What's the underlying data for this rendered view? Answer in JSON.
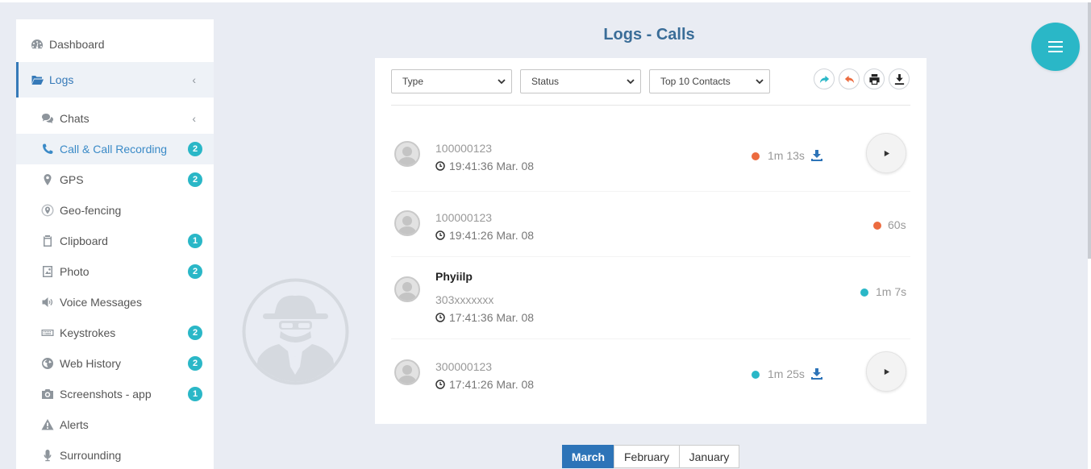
{
  "page": {
    "title": "Logs - Calls"
  },
  "sidebar": {
    "top_items": [
      {
        "label": "Dashboard",
        "icon": "dashboard-icon"
      },
      {
        "label": "Logs",
        "icon": "folder-open-icon"
      }
    ],
    "sub_items": [
      {
        "label": "Chats",
        "icon": "chat-bubbles-icon",
        "badge": ""
      },
      {
        "label": "Call & Call Recording",
        "icon": "phone-icon",
        "badge": "2"
      },
      {
        "label": "GPS",
        "icon": "map-marker-icon",
        "badge": "2"
      },
      {
        "label": "Geo-fencing",
        "icon": "geofence-icon",
        "badge": ""
      },
      {
        "label": "Clipboard",
        "icon": "clipboard-icon",
        "badge": "1"
      },
      {
        "label": "Photo",
        "icon": "photo-icon",
        "badge": "2"
      },
      {
        "label": "Voice Messages",
        "icon": "volume-icon",
        "badge": ""
      },
      {
        "label": "Keystrokes",
        "icon": "keyboard-icon",
        "badge": "2"
      },
      {
        "label": "Web History",
        "icon": "globe-icon",
        "badge": "2"
      },
      {
        "label": "Screenshots - app",
        "icon": "camera-icon",
        "badge": "1"
      },
      {
        "label": "Alerts",
        "icon": "warning-icon",
        "badge": ""
      },
      {
        "label": "Surrounding",
        "icon": "microphone-icon",
        "badge": ""
      }
    ]
  },
  "filters": {
    "type": "Type",
    "status": "Status",
    "contacts": "Top 10 Contacts"
  },
  "toolbar": [
    "forward-icon",
    "reply-icon",
    "print-icon",
    "export-icon"
  ],
  "logs": [
    {
      "name": "",
      "contact": "100000123",
      "time": "19:41:36 Mar. 08",
      "duration": "1m 13s",
      "status_color": "#ec6b3f",
      "has_recording": true
    },
    {
      "name": "",
      "contact": "100000123",
      "time": "19:41:26 Mar. 08",
      "duration": "60s",
      "status_color": "#ec6b3f",
      "has_recording": false
    },
    {
      "name": "Phyiilp",
      "contact": "303xxxxxxx",
      "time": "17:41:36 Mar. 08",
      "duration": "1m 7s",
      "status_color": "#2ab7c7",
      "has_recording": false
    },
    {
      "name": "",
      "contact": "300000123",
      "time": "17:41:26 Mar. 08",
      "duration": "1m 25s",
      "status_color": "#2ab7c7",
      "has_recording": true
    }
  ],
  "months": [
    "March",
    "February",
    "January"
  ],
  "colors": {
    "accent": "#2ab7c7",
    "primary": "#2d74b8",
    "missed": "#ec6b3f"
  }
}
